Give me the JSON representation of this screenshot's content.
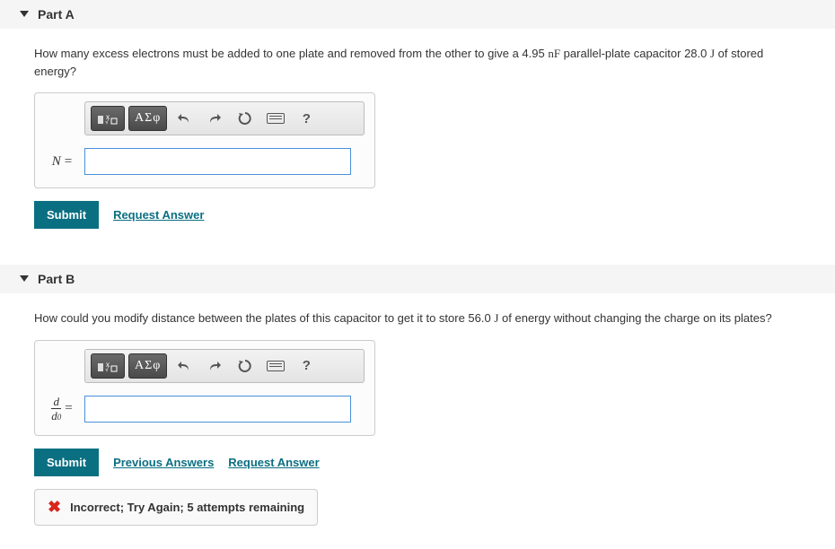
{
  "partA": {
    "title": "Part A",
    "question_pre": "How many excess electrons must be added to one plate and removed from the other to give a 4.95 ",
    "unit1": "nF",
    "question_mid": " parallel-plate capacitor 28.0 ",
    "unit2": "J",
    "question_post": " of stored energy?",
    "answer_label": "N",
    "submit": "Submit",
    "request": "Request Answer",
    "toolbar": {
      "greek_label": "ΑΣφ",
      "help": "?"
    }
  },
  "partB": {
    "title": "Part B",
    "question_pre": "How could you modify distance between the plates of this capacitor to get it to store 56.0 ",
    "unit1": "J",
    "question_post": " of energy without changing the charge on its plates?",
    "answer_num": "d",
    "answer_den_main": "d",
    "answer_den_sub": "0",
    "submit": "Submit",
    "previous": "Previous Answers",
    "request": "Request Answer",
    "toolbar": {
      "greek_label": "ΑΣφ",
      "help": "?"
    },
    "feedback": "Incorrect; Try Again; 5 attempts remaining"
  }
}
